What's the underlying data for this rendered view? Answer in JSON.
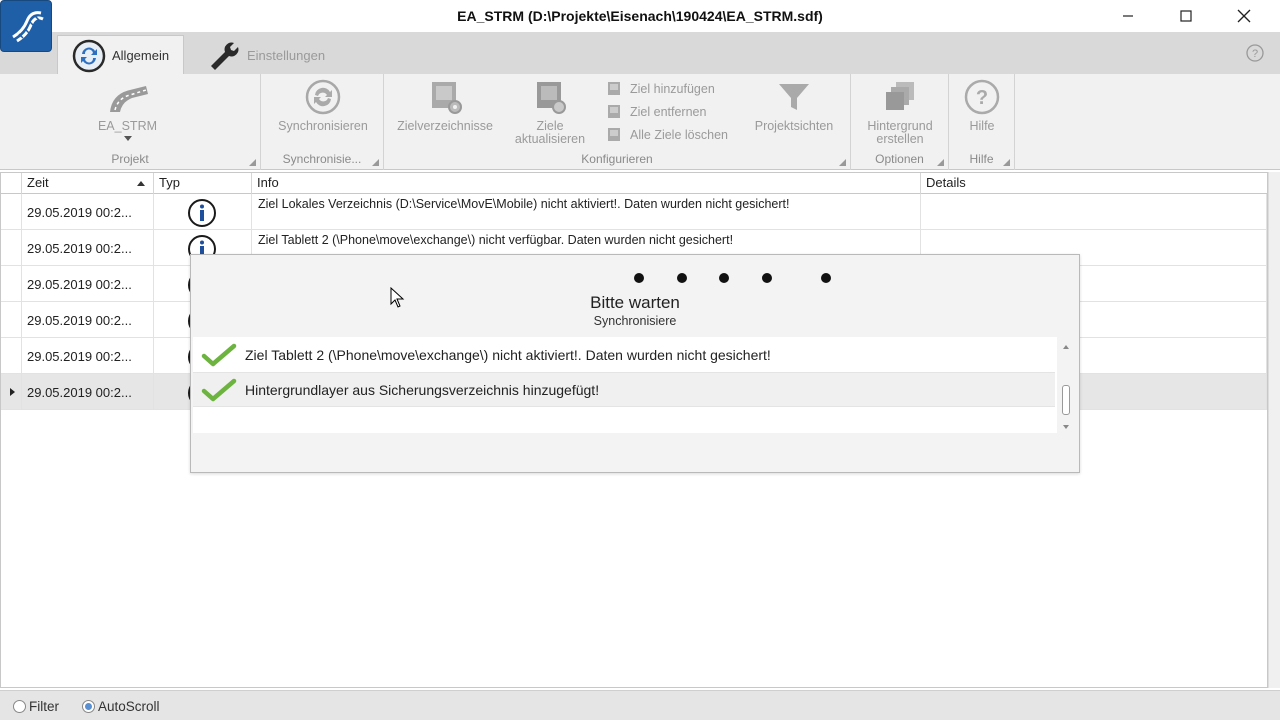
{
  "window": {
    "title": "EA_STRM (D:\\Projekte\\Eisenach\\190424\\EA_STRM.sdf)"
  },
  "tabs": [
    {
      "label": "Allgemein",
      "icon": "sync-icon",
      "active": true
    },
    {
      "label": "Einstellungen",
      "icon": "wrench-icon",
      "active": false
    }
  ],
  "ribbon": {
    "projekt": {
      "button": "EA_STRM",
      "group": "Projekt"
    },
    "synchronisieren": {
      "button": "Synchronisieren",
      "group": "Synchronisie..."
    },
    "konfigurieren": {
      "zielverzeichnisse": "Zielverzeichnisse",
      "ziele_line1": "Ziele",
      "ziele_line2": "aktualisieren",
      "ziel_hinzufuegen": "Ziel hinzufügen",
      "ziel_entfernen": "Ziel entfernen",
      "alle_ziele_loeschen": "Alle Ziele löschen",
      "projektsichten": "Projektsichten",
      "group": "Konfigurieren"
    },
    "optionen": {
      "line1": "Hintergrund",
      "line2": "erstellen",
      "group": "Optionen"
    },
    "hilfe": {
      "button": "Hilfe",
      "group": "Hilfe"
    }
  },
  "grid": {
    "columns": {
      "time": "Zeit",
      "type": "Typ",
      "info": "Info",
      "details": "Details"
    },
    "rows": [
      {
        "time": "29.05.2019 00:2...",
        "info": "Ziel Lokales Verzeichnis (D:\\Service\\MovE\\Mobile) nicht aktiviert!. Daten wurden nicht gesichert!",
        "details": ""
      },
      {
        "time": "29.05.2019 00:2...",
        "info": "Ziel Tablett 2 (\\Phone\\move\\exchange\\) nicht verfügbar. Daten wurden nicht gesichert!",
        "details": ""
      },
      {
        "time": "29.05.2019 00:2...",
        "info": "",
        "details": ""
      },
      {
        "time": "29.05.2019 00:2...",
        "info": "",
        "details": ""
      },
      {
        "time": "29.05.2019 00:2...",
        "info": "",
        "details": ""
      },
      {
        "time": "29.05.2019 00:2...",
        "info": "",
        "details": ""
      }
    ]
  },
  "dialog": {
    "title": "Bitte warten",
    "subtitle": "Synchronisiere",
    "items": [
      "Ziel Tablett 2 (\\Phone\\move\\exchange\\) nicht aktiviert!. Daten wurden nicht gesichert!",
      "Hintergrundlayer aus Sicherungsverzeichnis hinzugefügt!"
    ]
  },
  "statusbar": {
    "filter": "Filter",
    "autoscroll": "AutoScroll"
  },
  "colors": {
    "accent": "#1f5fa8",
    "check": "#6db33f",
    "ribbon_bg": "#f1f1f1",
    "tabs_bg": "#d9d9d9"
  }
}
